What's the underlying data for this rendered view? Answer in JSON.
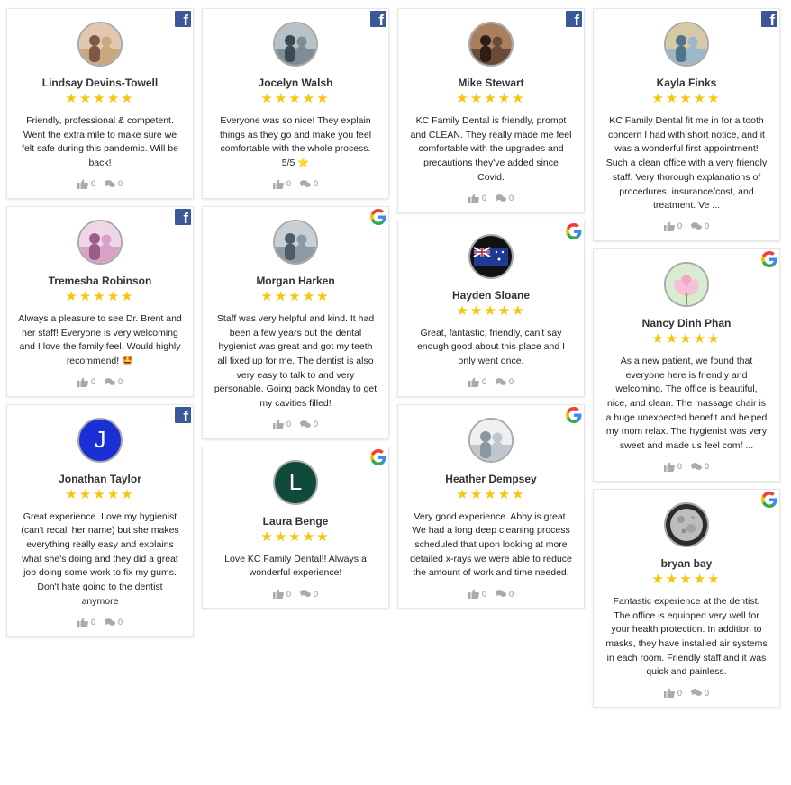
{
  "colors": {
    "facebook": "#3b5998",
    "star": "#f7c50c",
    "jonathan_avatar": "#1a2fd6",
    "laura_avatar": "#0f4a3a"
  },
  "icons": {
    "like": "thumbs-up-icon",
    "comment": "comment-icon",
    "facebook": "facebook-icon",
    "google": "google-icon"
  },
  "columns": [
    [
      {
        "source": "facebook",
        "name": "Lindsay Devins-Towell",
        "stars": "★★★★★",
        "rating": 5,
        "text": "Friendly, professional & competent. Went the extra mile to make sure we felt safe during this pandemic. Will be back!",
        "likes": "0",
        "comments": "0",
        "avatar": "photo",
        "avatar_letter": ""
      },
      {
        "source": "facebook",
        "name": "Tremesha Robinson",
        "stars": "★★★★★",
        "rating": 5,
        "text": "Always a pleasure to see Dr. Brent and her staff! Everyone is very welcoming and I love the family feel. Would highly recommend! 🤩",
        "likes": "0",
        "comments": "0",
        "avatar": "photo",
        "avatar_letter": ""
      },
      {
        "source": "facebook",
        "name": "Jonathan Taylor",
        "stars": "★★★★★",
        "rating": 5,
        "text": "Great experience. Love my hygienist (can't recall her name) but she makes everything really easy and explains what she's doing and they did a great job doing some work to fix my gums. Don't hate going to the dentist anymore",
        "likes": "0",
        "comments": "0",
        "avatar": "letter",
        "avatar_letter": "J"
      }
    ],
    [
      {
        "source": "facebook",
        "name": "Jocelyn Walsh",
        "stars": "★★★★★",
        "rating": 5,
        "text": "Everyone was so nice! They explain things as they go and make you feel comfortable with the whole process. 5/5 ⭐",
        "likes": "0",
        "comments": "0",
        "avatar": "photo",
        "avatar_letter": ""
      },
      {
        "source": "google",
        "name": "Morgan Harken",
        "stars": "★★★★★",
        "rating": 5,
        "text": "Staff was very helpful and kind. It had been a few years but the dental hygienist was great and got my teeth all fixed up for me. The dentist is also very easy to talk to and very personable. Going back Monday to get my cavities filled!",
        "likes": "0",
        "comments": "0",
        "avatar": "photo",
        "avatar_letter": ""
      },
      {
        "source": "google",
        "name": "Laura Benge",
        "stars": "★★★★★",
        "rating": 5,
        "text": "Love KC Family Dental!! Always a wonderful experience!",
        "likes": "0",
        "comments": "0",
        "avatar": "letter",
        "avatar_letter": "L"
      }
    ],
    [
      {
        "source": "facebook",
        "name": "Mike Stewart",
        "stars": "★★★★★",
        "rating": 5,
        "text": "KC Family Dental is friendly, prompt and CLEAN. They really made me feel comfortable with the upgrades and precautions they've added since Covid.",
        "likes": "0",
        "comments": "0",
        "avatar": "photo",
        "avatar_letter": ""
      },
      {
        "source": "google",
        "name": "Hayden Sloane",
        "stars": "★★★★★",
        "rating": 5,
        "text": "Great, fantastic, friendly, can't say enough good about this place and I only went once.",
        "likes": "0",
        "comments": "0",
        "avatar": "flag",
        "avatar_letter": ""
      },
      {
        "source": "google",
        "name": "Heather Dempsey",
        "stars": "★★★★★",
        "rating": 5,
        "text": "Very good experience. Abby is great. We had a long deep cleaning process scheduled that upon looking at more detailed x-rays we were able to reduce the amount of work and time needed.",
        "likes": "0",
        "comments": "0",
        "avatar": "photo",
        "avatar_letter": ""
      }
    ],
    [
      {
        "source": "facebook",
        "name": "Kayla Finks",
        "stars": "★★★★★",
        "rating": 5,
        "text": "KC Family Dental fit me in for a tooth concern I had with short notice, and it was a wonderful first appointment! Such a clean office with a very friendly staff. Very thorough explanations of procedures, insurance/cost, and treatment. Ve ...",
        "likes": "0",
        "comments": "0",
        "avatar": "photo",
        "avatar_letter": ""
      },
      {
        "source": "google",
        "name": "Nancy Dinh Phan",
        "stars": "★★★★★",
        "rating": 5,
        "text": "As a new patient, we found that everyone here is friendly and welcoming. The office is beautiful, nice, and clean. The massage chair is a huge unexpected benefit and helped my mom relax. The hygienist was very sweet and made us feel comf ...",
        "likes": "0",
        "comments": "0",
        "avatar": "lotus",
        "avatar_letter": ""
      },
      {
        "source": "google",
        "name": "bryan bay",
        "stars": "★★★★★",
        "rating": 5,
        "text": "Fantastic experience at the dentist. The office is equipped very well for your health protection. In addition to masks, they have installed air systems in each room. Friendly staff and it was quick and painless.",
        "likes": "0",
        "comments": "0",
        "avatar": "moon",
        "avatar_letter": ""
      }
    ]
  ]
}
